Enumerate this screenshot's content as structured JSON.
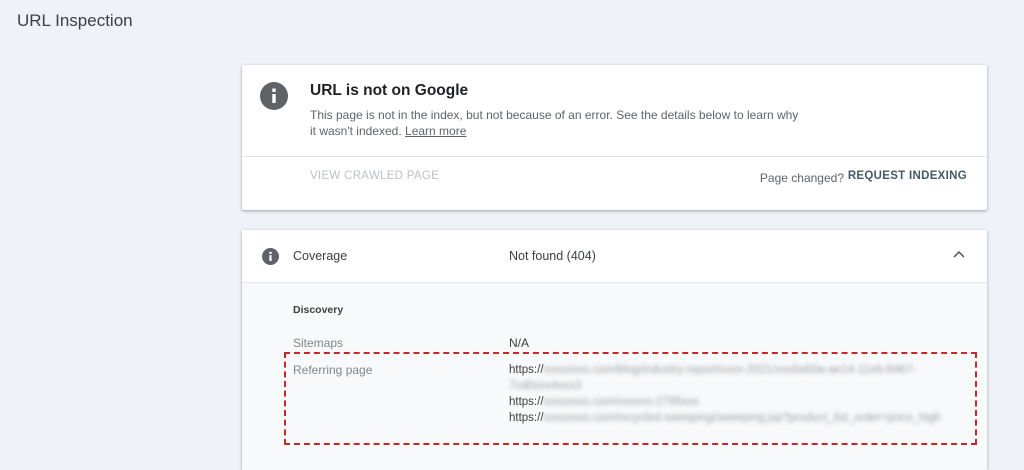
{
  "page": {
    "title": "URL Inspection"
  },
  "status": {
    "title": "URL is not on Google",
    "description": "This page is not in the index, but not because of an error. See the details below to learn why it wasn't indexed.",
    "learn_more": "Learn more",
    "view_crawled": "VIEW CRAWLED PAGE",
    "page_changed": "Page changed?",
    "request_indexing": "REQUEST INDEXING"
  },
  "coverage": {
    "label": "Coverage",
    "value": "Not found (404)",
    "discovery": {
      "heading": "Discovery",
      "sitemaps_label": "Sitemaps",
      "sitemaps_value": "N/A",
      "referring_label": "Referring page",
      "referring_pages": [
        {
          "prefix": "https://",
          "blurred": "xxxxxxxx.com/blog/industry-report/xxxx-2021/xxx5a50a-ae14-11eb-8467-7cd0xxx4xxx3"
        },
        {
          "prefix": "https://",
          "blurred": "xxxxxxxx.com/xxxxxx-2795xxx"
        },
        {
          "prefix": "https://",
          "blurred": "xxxxxxxx.com/recycled-sweeping/sweeping.jsp?product_list_order=price_high"
        }
      ]
    }
  },
  "colors": {
    "background": "#eff2f9",
    "highlight": "#c62828",
    "info_icon": "#5f6368"
  },
  "icons": {
    "status_icon": "info-icon",
    "coverage_icon": "info-icon",
    "chevron": "chevron-up-icon"
  }
}
